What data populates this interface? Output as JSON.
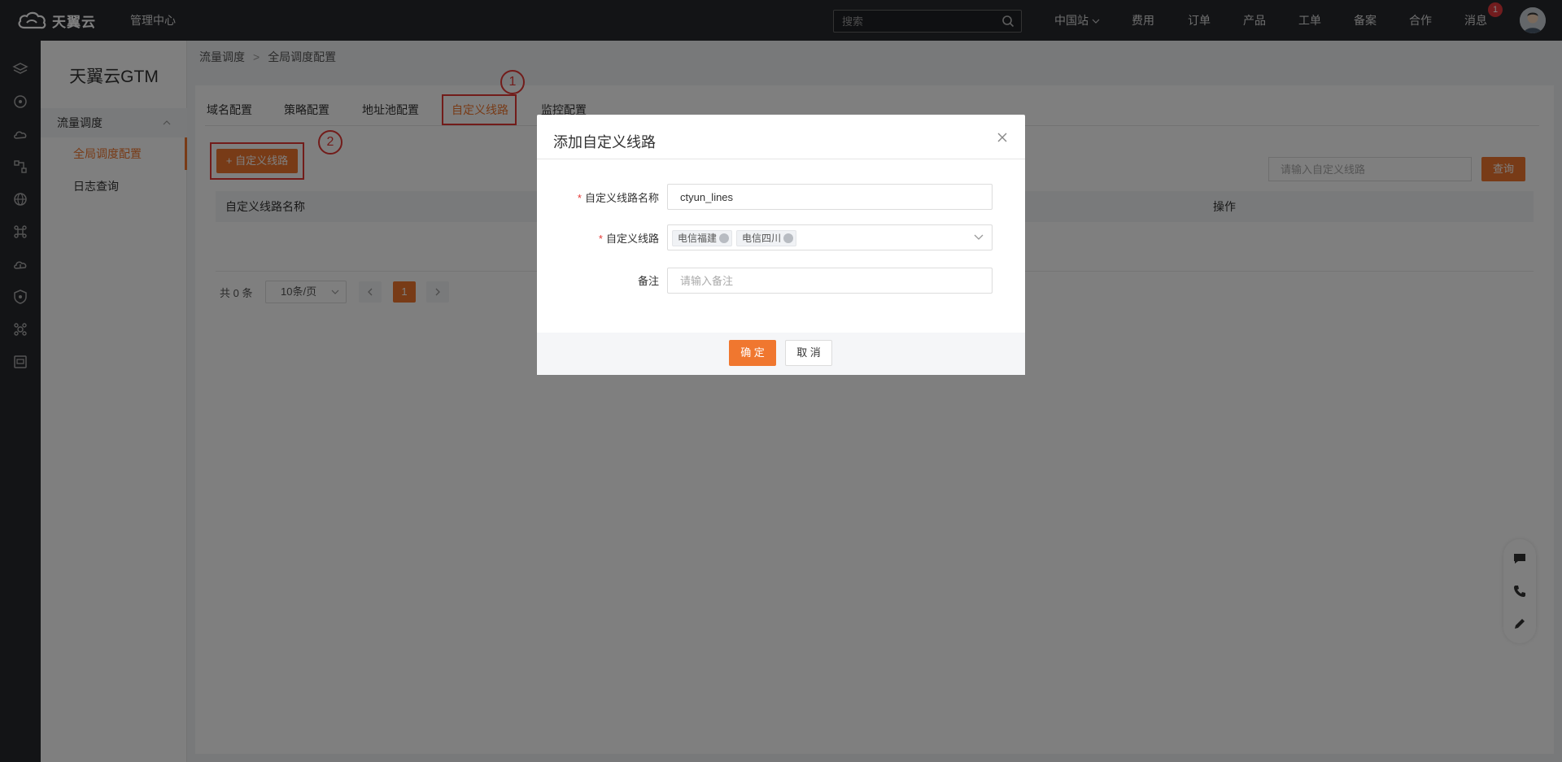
{
  "header": {
    "logo_text": "天翼云",
    "console_label": "管理中心",
    "search_placeholder": "搜索",
    "nav": [
      "中国站",
      "费用",
      "订单",
      "产品",
      "工单",
      "备案",
      "合作",
      "消息"
    ],
    "message_badge": "1"
  },
  "rail": {
    "icons": [
      "layers-icon",
      "network-icon",
      "cloud-icon",
      "topology-icon",
      "globe-icon",
      "node-icon",
      "cloud-upload-icon",
      "shield-icon",
      "node-alt-icon",
      "monitor-icon"
    ]
  },
  "sidebar": {
    "title": "天翼云GTM",
    "group": "流量调度",
    "items": [
      "全局调度配置",
      "日志查询"
    ]
  },
  "breadcrumb": [
    "流量调度",
    "全局调度配置"
  ],
  "tabs": [
    "域名配置",
    "策略配置",
    "地址池配置",
    "自定义线路",
    "监控配置"
  ],
  "active_tab": "自定义线路",
  "annotations": [
    "1",
    "2"
  ],
  "toolbar": {
    "add_label": "+ 自定义线路",
    "filter_placeholder": "请输入自定义线路",
    "query_label": "查询"
  },
  "table": {
    "columns": [
      "自定义线路名称",
      "操作"
    ]
  },
  "pagination": {
    "total": "共 0 条",
    "page_size": "10条/页",
    "current_page": "1"
  },
  "dialog": {
    "title": "添加自定义线路",
    "name_label": "自定义线路名称",
    "name_value": "ctyun_lines",
    "lines_label": "自定义线路",
    "lines_tags": [
      "电信福建",
      "电信四川"
    ],
    "remark_label": "备注",
    "remark_placeholder": "请输入备注",
    "ok_label": "确 定",
    "cancel_label": "取 消"
  },
  "colors": {
    "accent": "#f0772f",
    "topbar": "#26282d",
    "highlight": "#e53935"
  }
}
